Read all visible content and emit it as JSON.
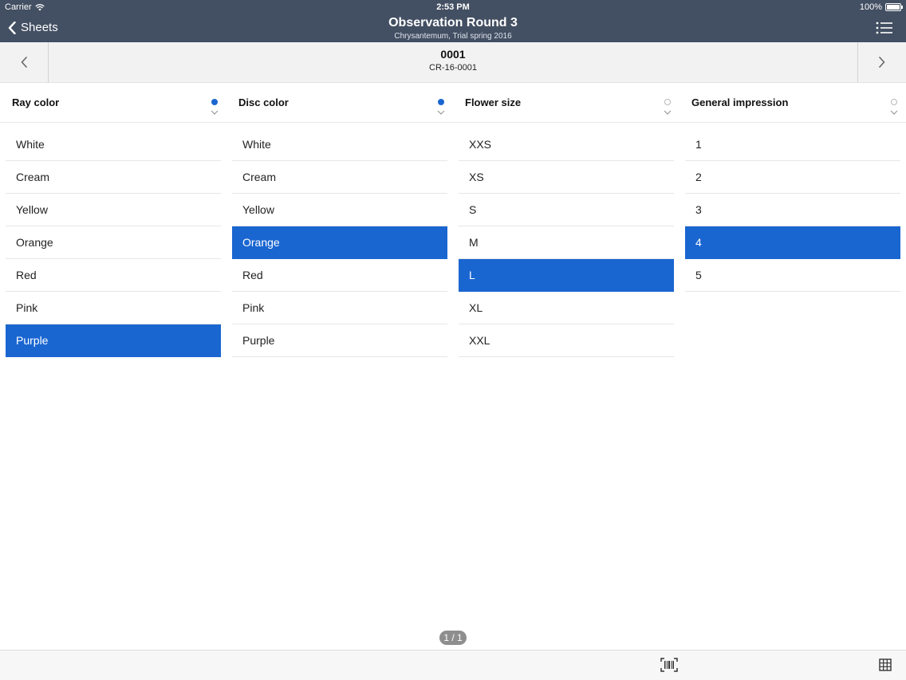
{
  "status_bar": {
    "carrier": "Carrier",
    "time": "2:53 PM",
    "battery": "100%"
  },
  "nav": {
    "back_label": "Sheets",
    "title": "Observation Round 3",
    "subtitle": "Chrysantemum, Trial spring 2016"
  },
  "record": {
    "id": "0001",
    "code": "CR-16-0001"
  },
  "columns": [
    {
      "label": "Ray color",
      "status": "filled",
      "options": [
        "White",
        "Cream",
        "Yellow",
        "Orange",
        "Red",
        "Pink",
        "Purple"
      ],
      "selected": 6
    },
    {
      "label": "Disc color",
      "status": "filled",
      "options": [
        "White",
        "Cream",
        "Yellow",
        "Orange",
        "Red",
        "Pink",
        "Purple"
      ],
      "selected": 3
    },
    {
      "label": "Flower size",
      "status": "empty",
      "options": [
        "XXS",
        "XS",
        "S",
        "M",
        "L",
        "XL",
        "XXL"
      ],
      "selected": 4
    },
    {
      "label": "General impression",
      "status": "empty",
      "options": [
        "1",
        "2",
        "3",
        "4",
        "5"
      ],
      "selected": 3
    }
  ],
  "pager": "1 / 1",
  "colors": {
    "nav_bg": "#434f62",
    "accent": "#1a66d1"
  },
  "icons": {
    "back": "chevron-left-icon",
    "menu": "list-icon",
    "prev": "chevron-left-icon",
    "next": "chevron-right-icon",
    "scan": "barcode-scan-icon",
    "grid": "grid-icon"
  }
}
